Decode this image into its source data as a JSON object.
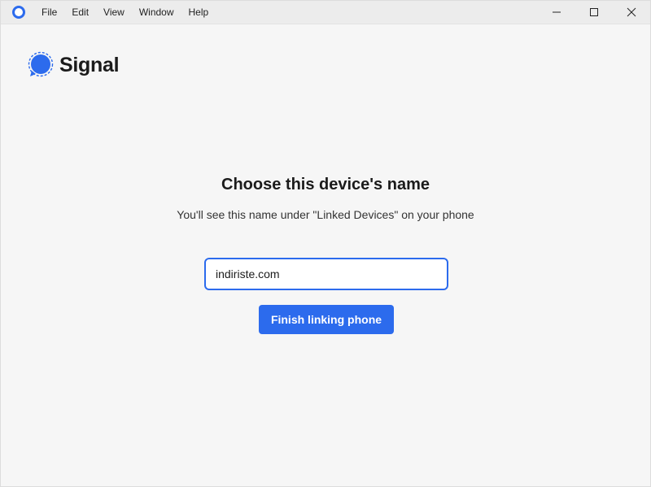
{
  "titlebar": {
    "app_icon": "signal-app-icon",
    "menu": [
      "File",
      "Edit",
      "View",
      "Window",
      "Help"
    ],
    "controls": {
      "minimize_icon": "minimize-icon",
      "maximize_icon": "maximize-icon",
      "close_icon": "close-icon"
    }
  },
  "brand": {
    "logo_icon": "signal-logo-icon",
    "name": "Signal"
  },
  "main": {
    "heading": "Choose this device's name",
    "subheading": "You'll see this name under \"Linked Devices\" on your phone",
    "device_name_value": "indiriste.com",
    "finish_button_label": "Finish linking phone"
  },
  "colors": {
    "accent": "#2c6bed",
    "background": "#f6f6f6",
    "titlebar": "#ececec"
  }
}
